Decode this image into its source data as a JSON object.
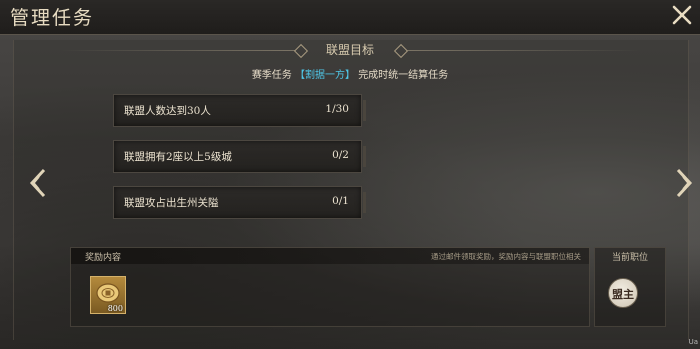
{
  "window": {
    "title": "管理任务"
  },
  "section": {
    "title": "联盟目标"
  },
  "subtitle": {
    "prefix": "赛季任务",
    "highlight": "【割据一方】",
    "suffix": "完成时统一结算任务"
  },
  "tasks": [
    {
      "name": "联盟人数达到30人",
      "progress": "1/30"
    },
    {
      "name": "联盟拥有2座以上5级城",
      "progress": "0/2"
    },
    {
      "name": "联盟攻占出生州关隘",
      "progress": "0/1"
    }
  ],
  "rewards": {
    "label": "奖励内容",
    "note": "通过邮件领取奖励，奖励内容与联盟职位相关",
    "items": [
      {
        "icon": "copper-coin-icon",
        "quantity": "800"
      }
    ]
  },
  "role": {
    "label": "当前职位",
    "badge": "盟主"
  },
  "corner": {
    "text": "Ua"
  },
  "colors": {
    "highlight": "#4fc7e8",
    "text": "#ece3d0",
    "accent": "#d4b16a"
  }
}
